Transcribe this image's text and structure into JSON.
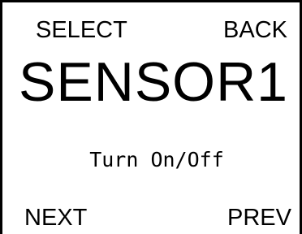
{
  "softkeys": {
    "select_label": "SELECT",
    "back_label": "BACK",
    "next_label": "NEXT",
    "prev_label": "PREV"
  },
  "screen": {
    "title": "SENSOR1",
    "option": "Turn On/Off"
  },
  "colors": {
    "background": "#ffffff",
    "foreground": "#000000"
  }
}
